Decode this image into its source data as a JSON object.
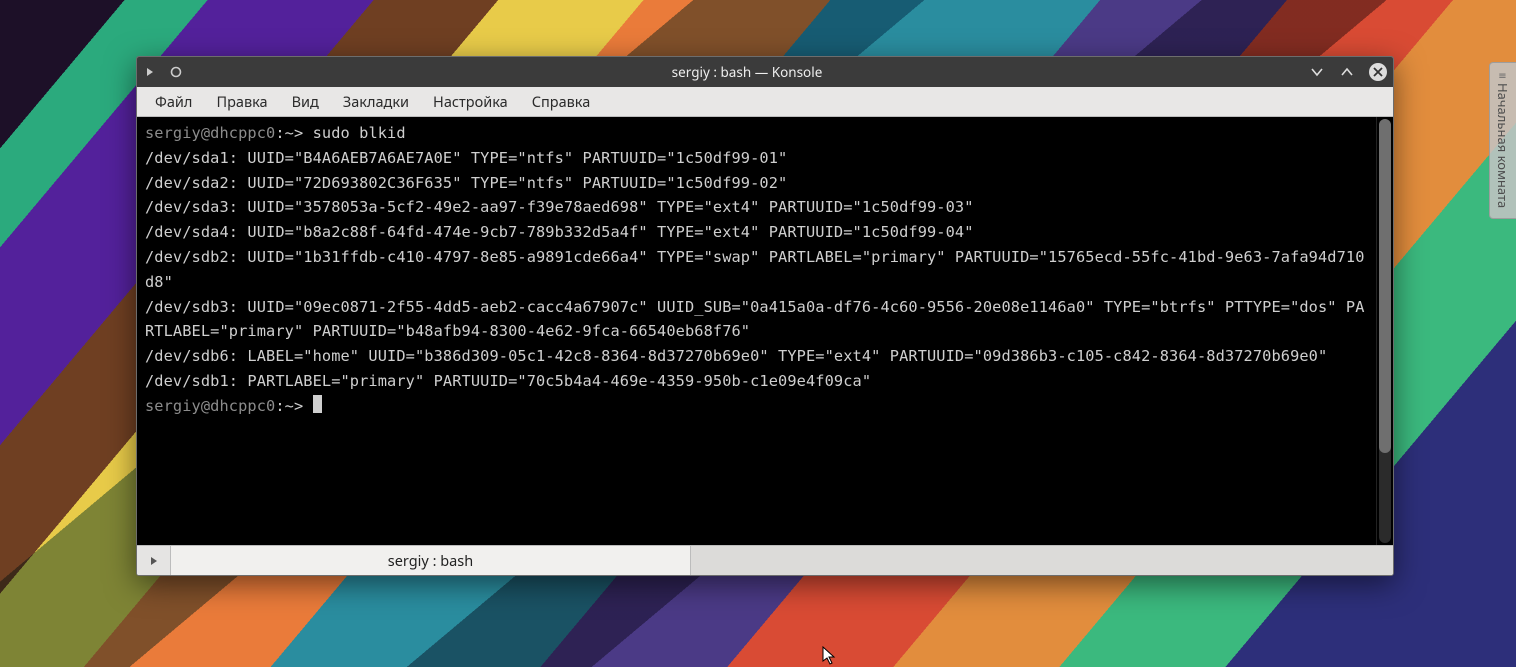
{
  "desktop": {
    "sideTabLabel": "Начальная комната"
  },
  "window": {
    "title": "sergiy : bash — Konsole",
    "menus": [
      "Файл",
      "Правка",
      "Вид",
      "Закладки",
      "Настройка",
      "Справка"
    ],
    "tabs": {
      "activeLabel": "sergiy : bash"
    }
  },
  "terminal": {
    "prompt1_user": "sergiy@dhcppc0",
    "prompt1_path": ":~> ",
    "command1": "sudo blkid",
    "outputLines": [
      "/dev/sda1: UUID=\"B4A6AEB7A6AE7A0E\" TYPE=\"ntfs\" PARTUUID=\"1c50df99-01\"",
      "/dev/sda2: UUID=\"72D693802C36F635\" TYPE=\"ntfs\" PARTUUID=\"1c50df99-02\"",
      "/dev/sda3: UUID=\"3578053a-5cf2-49e2-aa97-f39e78aed698\" TYPE=\"ext4\" PARTUUID=\"1c50df99-03\"",
      "/dev/sda4: UUID=\"b8a2c88f-64fd-474e-9cb7-789b332d5a4f\" TYPE=\"ext4\" PARTUUID=\"1c50df99-04\"",
      "/dev/sdb2: UUID=\"1b31ffdb-c410-4797-8e85-a9891cde66a4\" TYPE=\"swap\" PARTLABEL=\"primary\" PARTUUID=\"15765ecd-55fc-41bd-9e63-7afa94d710d8\"",
      "/dev/sdb3: UUID=\"09ec0871-2f55-4dd5-aeb2-cacc4a67907c\" UUID_SUB=\"0a415a0a-df76-4c60-9556-20e08e1146a0\" TYPE=\"btrfs\" PTTYPE=\"dos\" PARTLABEL=\"primary\" PARTUUID=\"b48afb94-8300-4e62-9fca-66540eb68f76\"",
      "/dev/sdb6: LABEL=\"home\" UUID=\"b386d309-05c1-42c8-8364-8d37270b69e0\" TYPE=\"ext4\" PARTUUID=\"09d386b3-c105-c842-8364-8d37270b69e0\"",
      "/dev/sdb1: PARTLABEL=\"primary\" PARTUUID=\"70c5b4a4-469e-4359-950b-c1e09e4f09ca\""
    ],
    "prompt2_user": "sergiy@dhcppc0",
    "prompt2_path": ":~> "
  }
}
